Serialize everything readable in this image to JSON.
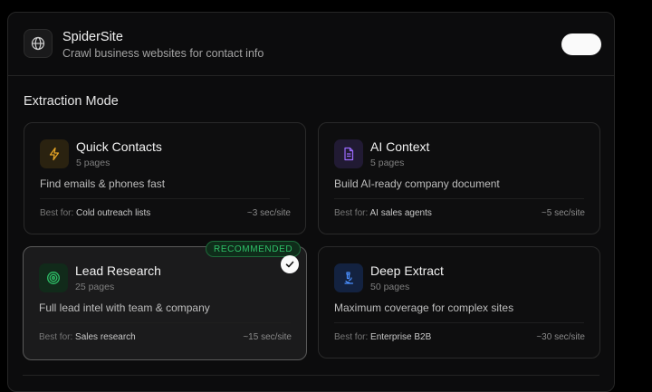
{
  "header": {
    "title": "SpiderSite",
    "subtitle": "Crawl business websites for contact info",
    "app_icon": "globe-icon",
    "toggle_on": true
  },
  "section": {
    "title": "Extraction Mode"
  },
  "best_for_label": "Best for:",
  "modes": [
    {
      "name": "Quick Contacts",
      "pages": "5 pages",
      "description": "Find emails & phones fast",
      "best_for": "Cold outreach lists",
      "time": "~3 sec/site",
      "icon": "lightning-icon",
      "accent": "#e3a325",
      "selected": false
    },
    {
      "name": "AI Context",
      "pages": "5 pages",
      "description": "Build AI-ready company document",
      "best_for": "AI sales agents",
      "time": "~5 sec/site",
      "icon": "document-icon",
      "accent": "#9b6bff",
      "selected": false
    },
    {
      "name": "Lead Research",
      "pages": "25 pages",
      "description": "Full lead intel with team & company",
      "best_for": "Sales research",
      "time": "~15 sec/site",
      "icon": "target-icon",
      "accent": "#2fbf68",
      "selected": true,
      "badge": "RECOMMENDED"
    },
    {
      "name": "Deep Extract",
      "pages": "50 pages",
      "description": "Maximum coverage for complex sites",
      "best_for": "Enterprise B2B",
      "time": "~30 sec/site",
      "icon": "microscope-icon",
      "accent": "#4a8fff",
      "selected": false
    }
  ]
}
